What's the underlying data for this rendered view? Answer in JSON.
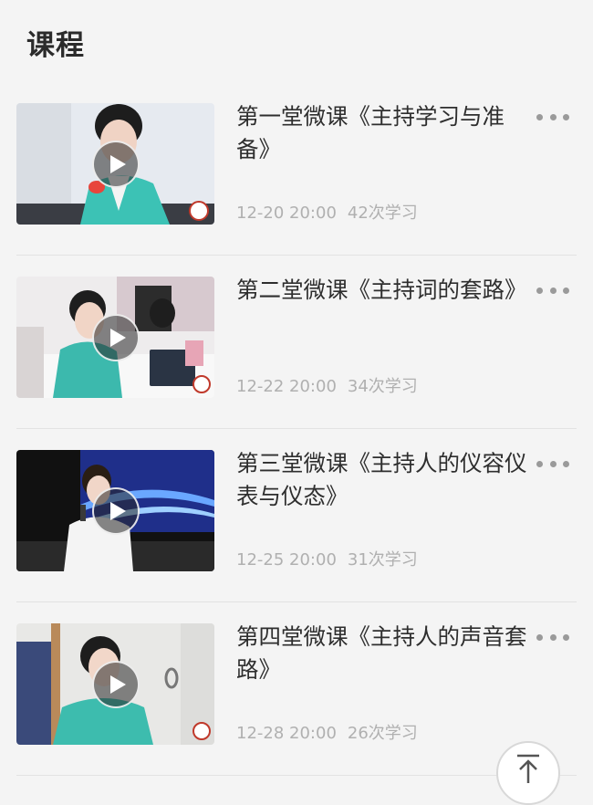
{
  "page": {
    "title": "课程"
  },
  "courses": [
    {
      "title": "第一堂微课《主持学习与准备》",
      "date": "12-20 20:00",
      "count": "42次学习",
      "thumb_bg": "#e9edf2",
      "thumb_accent": "#3fc1b5"
    },
    {
      "title": "第二堂微课《主持词的套路》",
      "date": "12-22 20:00",
      "count": "34次学习",
      "thumb_bg": "#f2f0f0",
      "thumb_accent": "#3fb7ad"
    },
    {
      "title": "第三堂微课《主持人的仪容仪表与仪态》",
      "date": "12-25 20:00",
      "count": "31次学习",
      "thumb_bg": "#1a2a6c",
      "thumb_accent": "#f5f5f5"
    },
    {
      "title": "第四堂微课《主持人的声音套路》",
      "date": "12-28 20:00",
      "count": "26次学习",
      "thumb_bg": "#eaeae8",
      "thumb_accent": "#3fbcae"
    }
  ],
  "icons": {
    "play": "play-icon",
    "more": "more-icon",
    "back_to_top": "arrow-up-icon"
  }
}
